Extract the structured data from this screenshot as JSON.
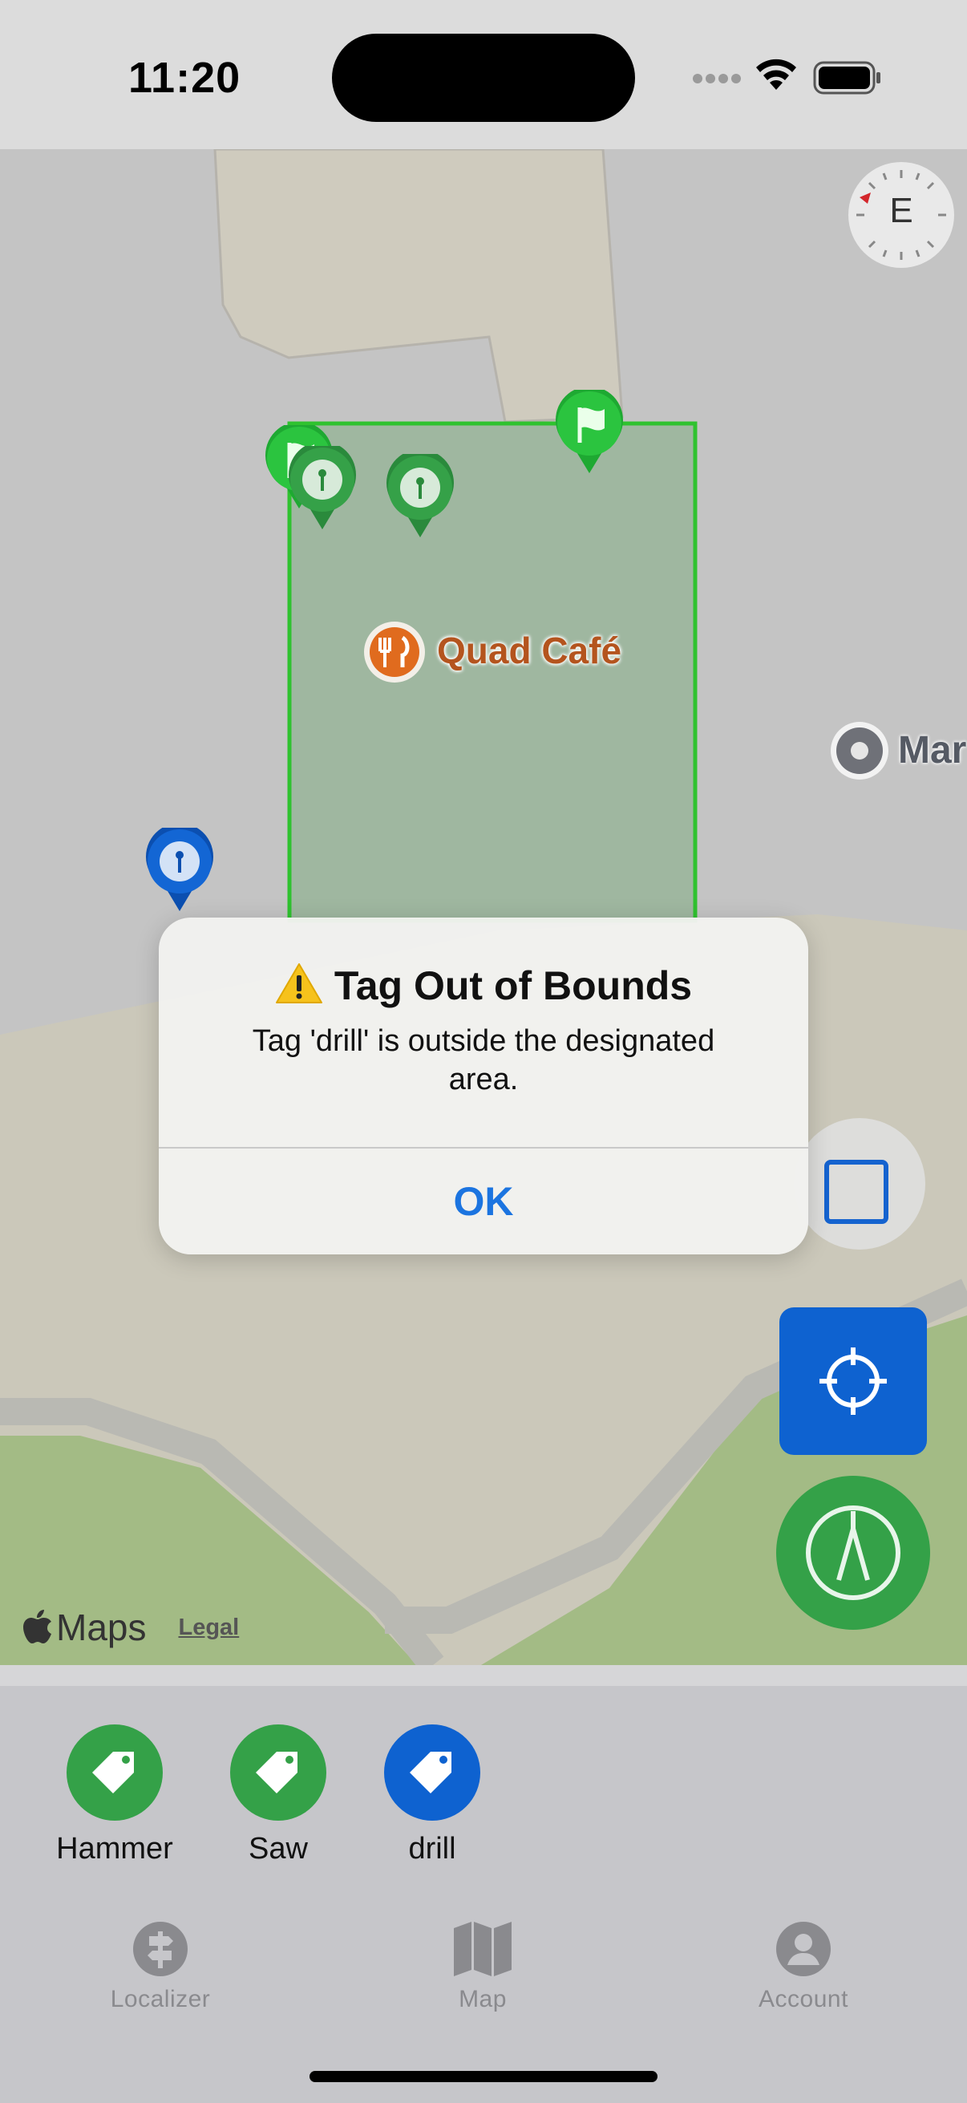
{
  "status_bar": {
    "time": "11:20"
  },
  "map": {
    "compass_heading": "E",
    "poi_label": "Quad Café",
    "poi_label_2": "Mar",
    "attribution": "Maps",
    "legal_link": "Legal"
  },
  "alert": {
    "title": "Tag Out of Bounds",
    "title_icon": "warning-icon",
    "message": "Tag 'drill' is outside the designated area.",
    "ok_label": "OK"
  },
  "tags": [
    {
      "name": "Hammer",
      "color": "#34a148"
    },
    {
      "name": "Saw",
      "color": "#34a148"
    },
    {
      "name": "drill",
      "color": "#0e62d0"
    }
  ],
  "tab_bar": {
    "items": [
      {
        "label": "Localizer",
        "icon": "signpost-icon"
      },
      {
        "label": "Map",
        "icon": "map-icon"
      },
      {
        "label": "Account",
        "icon": "person-icon"
      }
    ]
  },
  "colors": {
    "accent_blue": "#0e62d0",
    "accent_green": "#34a148",
    "boundary_green": "#2fc22f",
    "alert_button": "#1b74e0"
  }
}
